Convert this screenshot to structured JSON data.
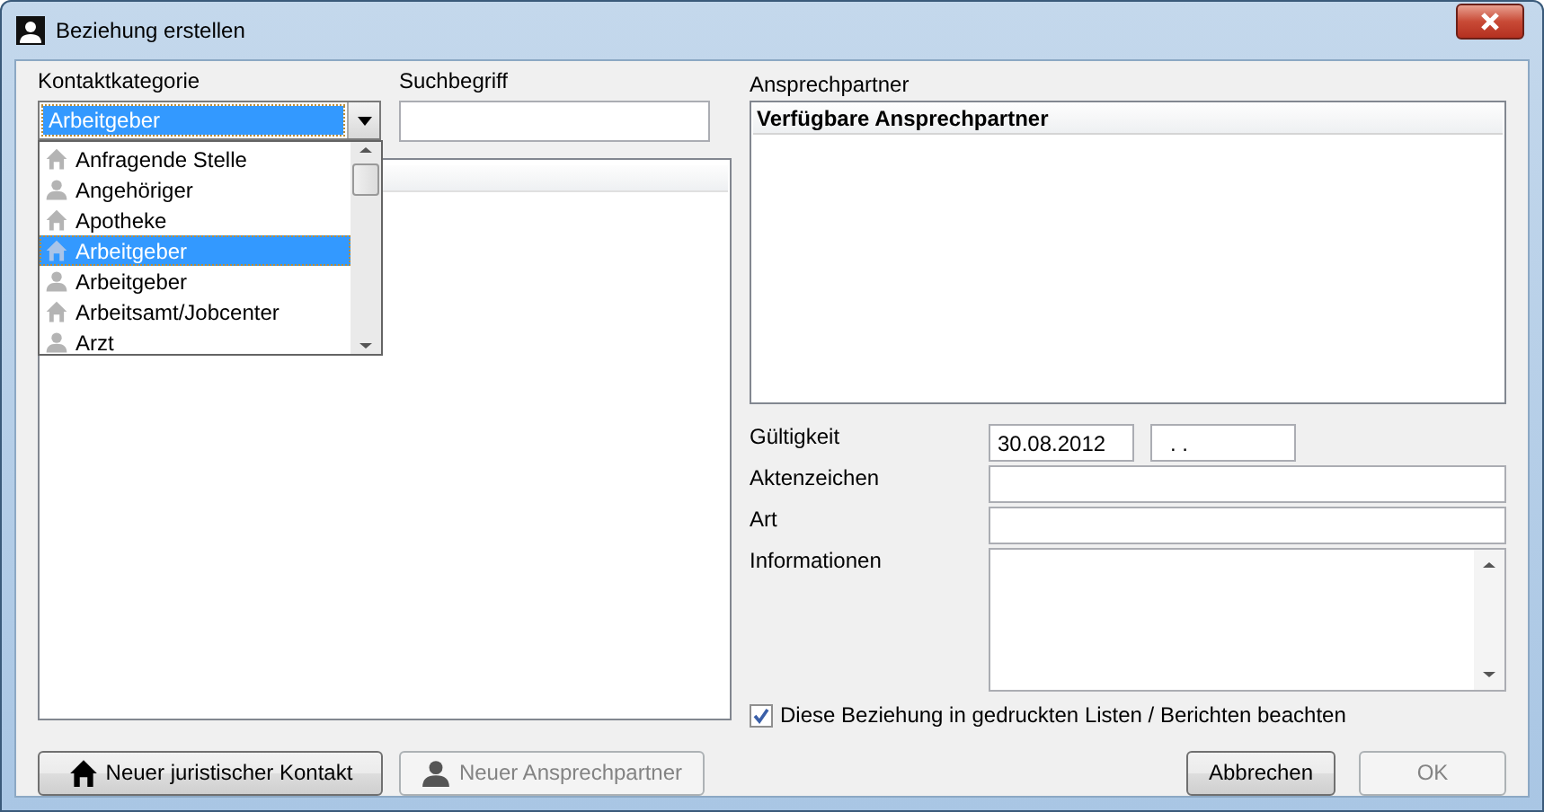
{
  "window": {
    "title": "Beziehung erstellen"
  },
  "category": {
    "label": "Kontaktkategorie",
    "value": "Arbeitgeber"
  },
  "category_options": [
    {
      "label": "Anfragende Stelle",
      "kind": "organization",
      "selected": false
    },
    {
      "label": "Angehöriger",
      "kind": "person",
      "selected": false
    },
    {
      "label": "Apotheke",
      "kind": "organization",
      "selected": false
    },
    {
      "label": "Arbeitgeber",
      "kind": "organization",
      "selected": true
    },
    {
      "label": "Arbeitgeber",
      "kind": "person",
      "selected": false
    },
    {
      "label": "Arbeitsamt/Jobcenter",
      "kind": "organization",
      "selected": false
    },
    {
      "label": "Arzt",
      "kind": "person",
      "selected": false
    }
  ],
  "search": {
    "label": "Suchbegriff"
  },
  "contacts": {
    "label": "Ansprechpartner",
    "header": "Verfügbare Ansprechpartner"
  },
  "validity": {
    "label": "Gültigkeit",
    "from": "30.08.2012",
    "to": ". ."
  },
  "fields": [
    {
      "label": "Aktenzeichen"
    },
    {
      "label": "Art"
    }
  ],
  "information": {
    "label": "Informationen"
  },
  "print_option": {
    "label": "Diese Beziehung in gedruckten Listen / Berichten beachten",
    "checked": true
  },
  "buttons_left": [
    {
      "label": "Neuer juristischer Kontakt",
      "kind": "house",
      "disabled": false
    },
    {
      "label": "Neuer Ansprechpartner",
      "kind": "person",
      "disabled": true
    }
  ],
  "buttons_right": [
    {
      "label": "Abbrechen",
      "disabled": false
    },
    {
      "label": "OK",
      "disabled": true
    }
  ]
}
